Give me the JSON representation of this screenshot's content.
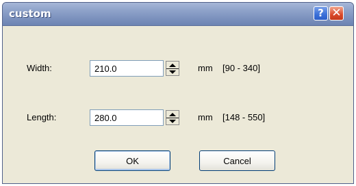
{
  "dialog": {
    "title": "custom",
    "help_glyph": "?",
    "close_glyph": "✕"
  },
  "fields": {
    "width": {
      "label": "Width:",
      "value": "210.0",
      "unit": "mm",
      "range": "[90 - 340]"
    },
    "length": {
      "label": "Length:",
      "value": "280.0",
      "unit": "mm",
      "range": "[148 - 550]"
    }
  },
  "buttons": {
    "ok": "OK",
    "cancel": "Cancel"
  }
}
